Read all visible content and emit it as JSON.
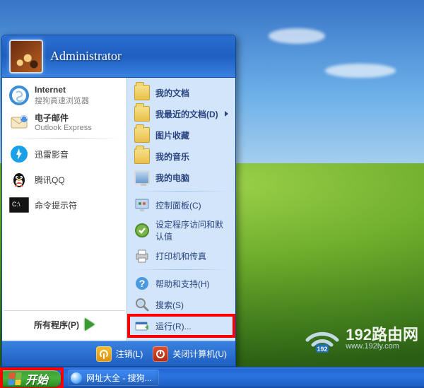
{
  "user": {
    "name": "Administrator"
  },
  "left_pinned": [
    {
      "title": "Internet",
      "sub": "搜狗高速浏览器",
      "icon": "sogou"
    },
    {
      "title": "电子邮件",
      "sub": "Outlook Express",
      "icon": "email"
    }
  ],
  "left_recent": [
    {
      "title": "迅雷影音",
      "icon": "xunlei"
    },
    {
      "title": "腾讯QQ",
      "icon": "qq"
    },
    {
      "title": "命令提示符",
      "icon": "cmd"
    }
  ],
  "all_programs_label": "所有程序(P)",
  "right_groups": [
    [
      {
        "label": "我的文档",
        "bold": true,
        "icon": "folder"
      },
      {
        "label": "我最近的文档(D)",
        "bold": true,
        "icon": "folder",
        "arrow": true
      },
      {
        "label": "图片收藏",
        "bold": true,
        "icon": "folder"
      },
      {
        "label": "我的音乐",
        "bold": true,
        "icon": "folder"
      },
      {
        "label": "我的电脑",
        "bold": true,
        "icon": "monitor"
      }
    ],
    [
      {
        "label": "控制面板(C)",
        "icon": "control"
      },
      {
        "label": "设定程序访问和默认值",
        "icon": "defaults"
      },
      {
        "label": "打印机和传真",
        "icon": "printer"
      }
    ],
    [
      {
        "label": "帮助和支持(H)",
        "icon": "help"
      },
      {
        "label": "搜索(S)",
        "icon": "search"
      },
      {
        "label": "运行(R)...",
        "icon": "run",
        "highlight": true
      }
    ]
  ],
  "footer": {
    "logoff": "注销(L)",
    "shutdown": "关闭计算机(U)"
  },
  "taskbar": {
    "start": "开始",
    "task1": "网址大全 - 搜狗..."
  },
  "watermark": {
    "big": "192路由网",
    "small": "www.192ly.com"
  }
}
